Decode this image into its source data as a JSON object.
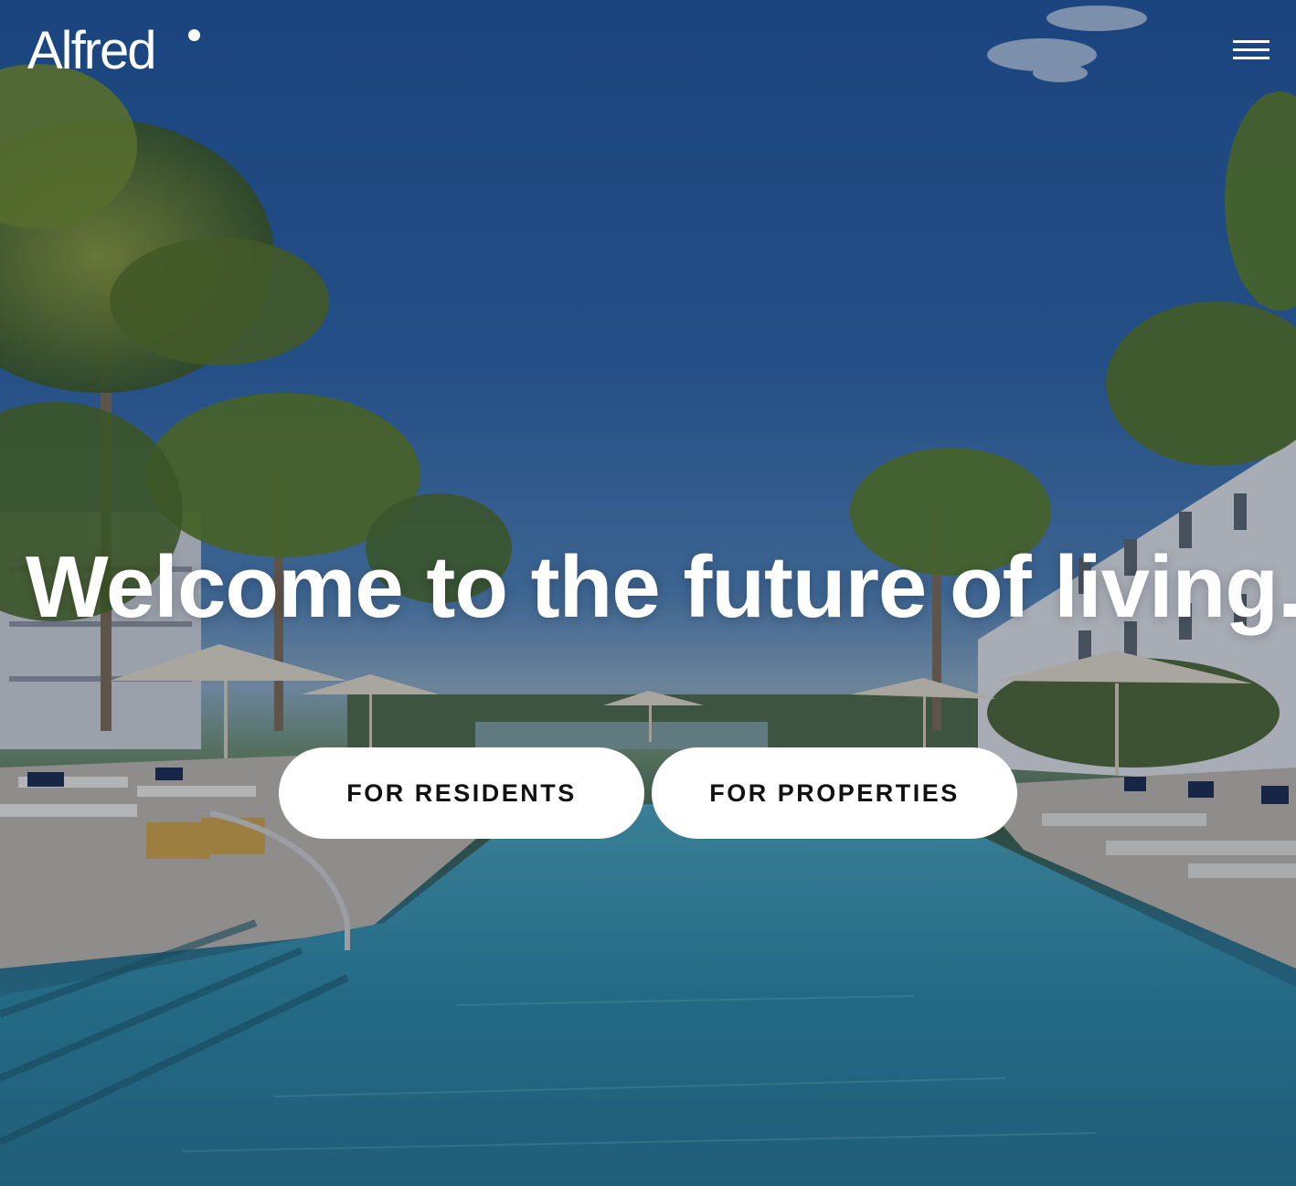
{
  "header": {
    "logo_text": "Alfred",
    "menu_icon": "hamburger-menu-icon"
  },
  "hero": {
    "background": "pool-with-palm-trees-photo",
    "headline": "Welcome to the future of living.",
    "buttons": {
      "residents_label": "FOR RESIDENTS",
      "properties_label": "FOR PROPERTIES"
    }
  },
  "colors": {
    "text": "#ffffff",
    "button_bg": "#ffffff",
    "button_text": "#111111",
    "sky": "#24569a",
    "water": "#2d7a95"
  }
}
